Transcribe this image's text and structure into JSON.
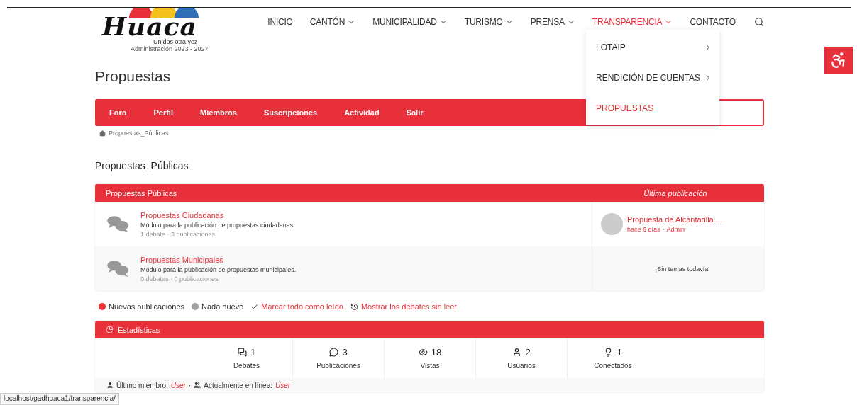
{
  "logo": {
    "name": "Huaca",
    "tagline": "Unidos otra vez",
    "subtitle": "Administración 2023 - 2027"
  },
  "nav": [
    {
      "label": "INICIO",
      "dropdown": false,
      "selected": false
    },
    {
      "label": "CANTÓN",
      "dropdown": true,
      "selected": false
    },
    {
      "label": "MUNICIPALIDAD",
      "dropdown": true,
      "selected": false
    },
    {
      "label": "TURISMO",
      "dropdown": true,
      "selected": false
    },
    {
      "label": "PRENSA",
      "dropdown": true,
      "selected": false
    },
    {
      "label": "TRANSPARENCIA",
      "dropdown": true,
      "selected": true
    },
    {
      "label": "CONTACTO",
      "dropdown": false,
      "selected": false
    }
  ],
  "submenu": [
    {
      "label": "LOTAIP",
      "submenu": true,
      "selected": false
    },
    {
      "label": "RENDICIÓN DE CUENTAS",
      "submenu": true,
      "selected": false
    },
    {
      "label": "PROPUESTAS",
      "submenu": false,
      "selected": true
    }
  ],
  "page_title": "Propuestas",
  "forum_menu": [
    "Foro",
    "Perfil",
    "Miembros",
    "Suscripciones",
    "Actividad",
    "Salir"
  ],
  "breadcrumb": "Propuestas_Públicas",
  "section_title": "Propuestas_Públicas",
  "table": {
    "title": "Propuestas Públicas",
    "last_post_heading": "Última publicación",
    "rows": [
      {
        "name": "Propuestas Ciudadanas",
        "description": "Módulo para la publicación de propuestas ciudadanas.",
        "counts": "1 debate · 3 publicaciones",
        "last_post": {
          "kind": "post",
          "title": "Propuesta de Alcantarilla ...",
          "time": "hace 6 días",
          "separator": "·",
          "author": "Admin"
        }
      },
      {
        "name": "Propuestas Municipales",
        "description": "Módulo para la publicación de propuestas municipales.",
        "counts": "0 debates · 0 publicaciones",
        "last_post": {
          "kind": "empty",
          "text": "¡Sin temas todavía!"
        }
      }
    ]
  },
  "legend": [
    {
      "kind": "dot",
      "label": "Nuevas publicaciones",
      "color": "#e8303a"
    },
    {
      "kind": "dot",
      "label": "Nada nuevo",
      "color": "#a0a0a0"
    },
    {
      "kind": "check",
      "label": "Marcar todo como leído"
    },
    {
      "kind": "history",
      "label": "Mostrar los debates sin leer"
    }
  ],
  "stats": {
    "title": "Estadísticas",
    "items": [
      {
        "kind": "debates",
        "value": "1",
        "label": "Debates"
      },
      {
        "kind": "posts",
        "value": "3",
        "label": "Publicaciones"
      },
      {
        "kind": "views",
        "value": "18",
        "label": "Vistas"
      },
      {
        "kind": "users",
        "value": "2",
        "label": "Usuarios"
      },
      {
        "kind": "online",
        "value": "1",
        "label": "Conectados"
      }
    ],
    "last_member_label": "Último miembro:",
    "last_member": "User",
    "separator": "·",
    "online_label": "Actualmente en línea:",
    "online_user": "User"
  },
  "status_bar": "localhost/gadhuaca1/transparencia/"
}
